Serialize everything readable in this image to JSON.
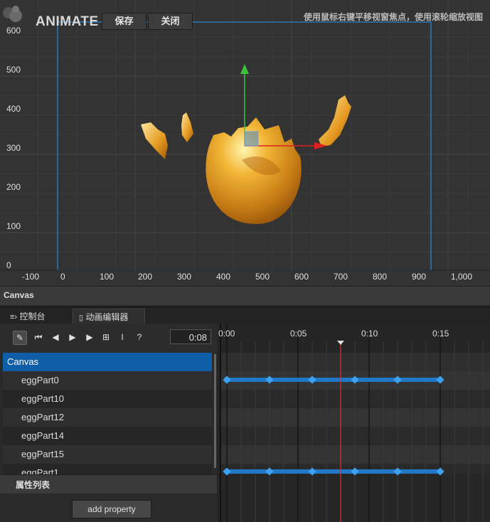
{
  "header": {
    "app_title": "ANIMATE",
    "save_label": "保存",
    "close_label": "关闭",
    "hint": "使用鼠标右键平移视窗焦点，使用滚轮缩放视图"
  },
  "scene": {
    "y_axis": [
      "600",
      "500",
      "400",
      "300",
      "200",
      "100",
      "0"
    ],
    "x_axis": [
      "-100",
      "0",
      "100",
      "200",
      "300",
      "400",
      "500",
      "600",
      "700",
      "800",
      "900",
      "1,000"
    ],
    "canvas_label": "Canvas"
  },
  "tabs": {
    "console": "控制台",
    "animation_editor": "动画编辑器"
  },
  "timeline": {
    "current_time": "0:08",
    "markers": [
      "0:00",
      "0:05",
      "0:10",
      "0:15"
    ]
  },
  "nodes": [
    "Canvas",
    "eggPart0",
    "eggPart10",
    "eggPart12",
    "eggPart14",
    "eggPart15",
    "eggPart1"
  ],
  "properties": {
    "header": "属性列表",
    "add_label": "add property"
  },
  "colors": {
    "selection": "#0f5ea8",
    "keyframe": "#3ea0f0",
    "playhead": "#e03030",
    "canvas_border": "#2a8ad8",
    "gizmo_y": "#40c040",
    "gizmo_x": "#e02020"
  },
  "icons": [
    "edit-icon",
    "first-frame-icon",
    "prev-frame-icon",
    "play-icon",
    "next-frame-icon",
    "add-keyframe-icon",
    "insert-icon",
    "help-icon"
  ]
}
